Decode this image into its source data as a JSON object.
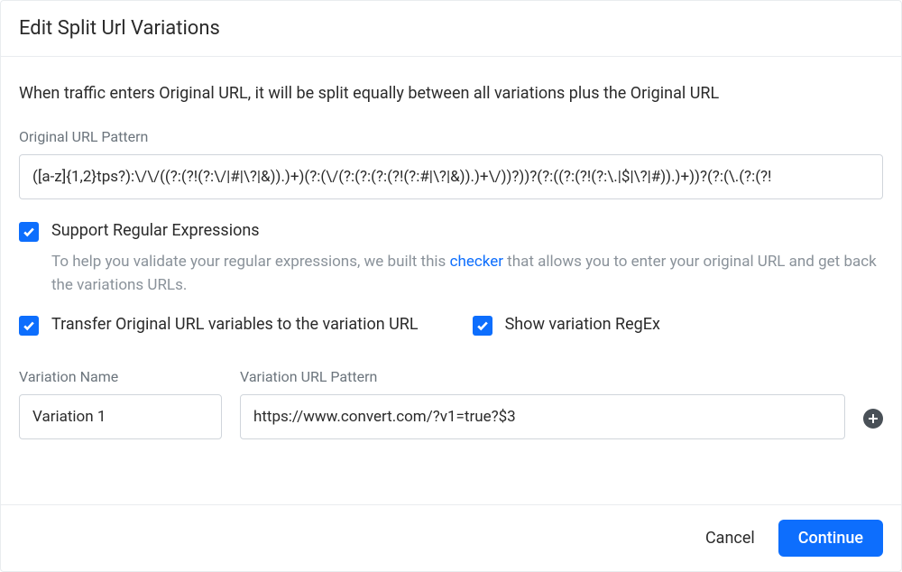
{
  "header": {
    "title": "Edit Split Url Variations"
  },
  "intro": "When traffic enters Original URL, it will be split equally between all variations plus the Original URL",
  "original": {
    "label": "Original URL Pattern",
    "value": "([a-z]{1,2}tps?):\\/\\/((?:(?!(?:\\/|#|\\?|&)).)+)(?:(\\/(?:(?:(?:(?!(?:#|\\?|&)).)+\\/))?))?(?:((?:(?!(?:\\.|$|\\?|#)).)+))?(?:(\\.(?:(?!"
  },
  "checkboxes": {
    "regex": {
      "label": "Support Regular Expressions",
      "checked": true,
      "help_pre": "To help you validate your regular expressions, we built this ",
      "help_link": "checker",
      "help_post": " that allows you to enter your original URL and get back the variations URLs."
    },
    "transfer": {
      "label": "Transfer Original URL variables to the variation URL",
      "checked": true
    },
    "show_regex": {
      "label": "Show variation RegEx",
      "checked": true
    }
  },
  "variation": {
    "name_label": "Variation Name",
    "name_value": "Variation 1",
    "url_label": "Variation URL Pattern",
    "url_value": "https://www.convert.com/?v1=true?$3"
  },
  "footer": {
    "cancel": "Cancel",
    "continue": "Continue"
  }
}
